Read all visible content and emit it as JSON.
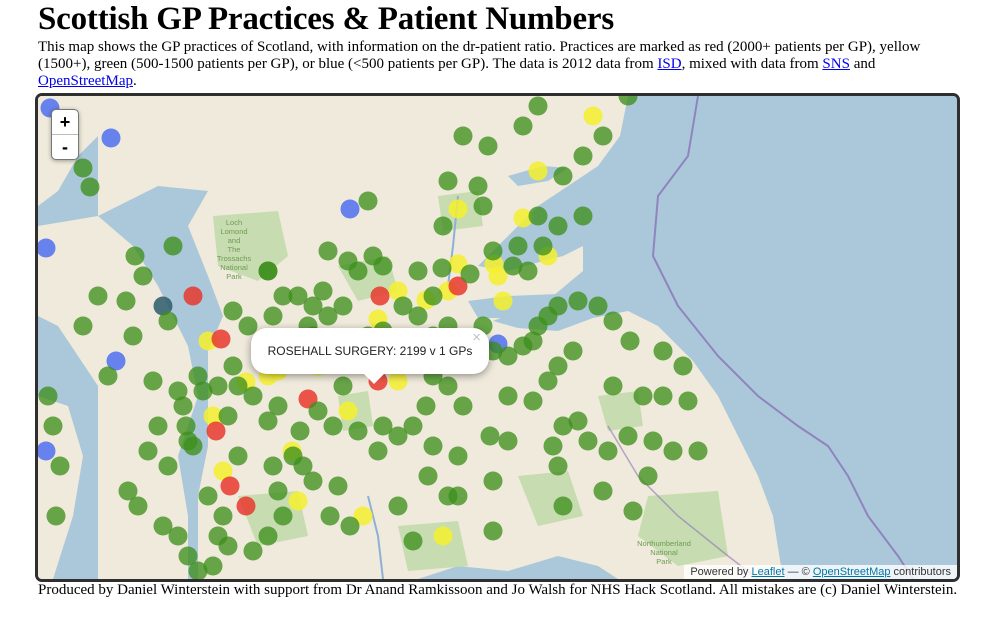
{
  "page": {
    "title": "Scottish GP Practices & Patient Numbers",
    "intro_1": "This map shows the GP practices of Scotland, with information on the dr-patient ratio. Practices are marked as red (2000+ patients per GP), yellow (1500+), green (500-1500 patients per GP), or blue (<500 patients per GP). The data is 2012 data from ",
    "intro_link_isd": "ISD",
    "intro_2": ", mixed with data from ",
    "intro_link_sns": "SNS",
    "intro_3": " and ",
    "intro_link_osm": "OpenStreetMap",
    "intro_4": "."
  },
  "map": {
    "zoom_in": "+",
    "zoom_out": "-",
    "place_labels": {
      "loch_lomond": [
        "Loch",
        "Lomond",
        "and",
        "The",
        "Trossachs",
        "National",
        "Park"
      ],
      "northumberland": [
        "Northumberland",
        "National",
        "Park"
      ]
    },
    "popup": {
      "text": "ROSEHALL SURGERY: 2199 v 1 GPs",
      "close": "×"
    },
    "attribution": {
      "prefix": "Powered by ",
      "leaflet": "Leaflet",
      "sep": " — © ",
      "osm": "OpenStreetMap",
      "suffix": " contributors"
    },
    "legend_colors": {
      "red": "#e8382e",
      "yellow": "#f5f02e",
      "green": "#3f8f1e",
      "blue": "#4f6ff0"
    }
  },
  "footer": {
    "text": "Produced by Daniel Winterstein with support from Dr Anand Ramkissoon and Jo Walsh for NHS Hack Scotland. All mistakes are (c) Daniel Winterstein."
  }
}
